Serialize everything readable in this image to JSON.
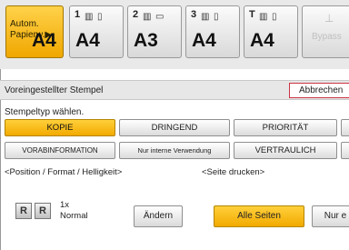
{
  "trays": [
    {
      "top": "Autom.",
      "bottom": "Papierw.▶",
      "size": "A4"
    },
    {
      "num": "1",
      "size": "A4"
    },
    {
      "num": "2",
      "size": "A3"
    },
    {
      "num": "3",
      "size": "A4"
    },
    {
      "num": "T",
      "size": "A4"
    },
    {
      "bypass": "Bypass"
    }
  ],
  "title": "Voreingestellter Stempel",
  "cancel": "Abbrechen",
  "stamp_type_label": "Stempeltyp wählen.",
  "row1": [
    "KOPIE",
    "DRINGEND",
    "PRIORITÄT"
  ],
  "row2": [
    "VORABINFORMATION",
    "Nur interne Verwendung",
    "VERTRAULICH"
  ],
  "position_label": "<Position / Format / Helligkeit>",
  "pages_label": "<Seite drucken>",
  "size_value": "1x",
  "density_value": "Normal",
  "change_button": "Ändern",
  "all_pages": "Alle Seiten",
  "first_page_partial": "Nur e"
}
